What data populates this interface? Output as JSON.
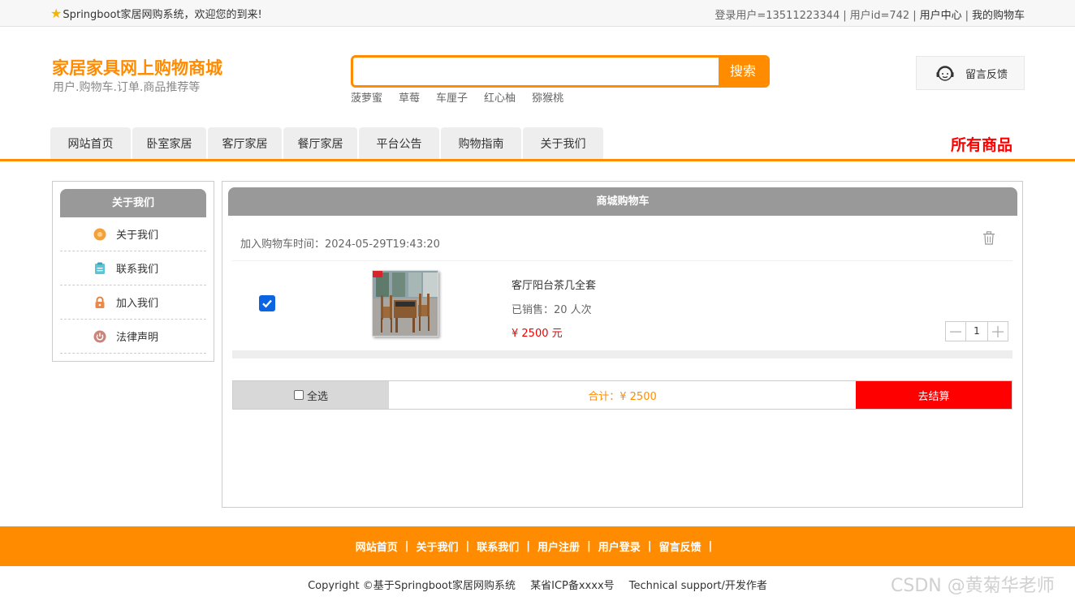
{
  "topbar": {
    "welcome": "Springboot家居网购系统，欢迎您的到来!",
    "login_user": "登录用户=13511223344",
    "user_id": "用户id=742",
    "user_center": "用户中心",
    "my_cart": "我的购物车",
    "separator": "|"
  },
  "header": {
    "title": "家居家具网上购物商城",
    "subtitle": "用户.购物车.订单.商品推荐等",
    "search": {
      "value": "",
      "button": "搜索"
    },
    "hot_words": [
      "菠萝蜜",
      "草莓",
      "车厘子",
      "红心柚",
      "猕猴桃"
    ],
    "feedback": "留言反馈"
  },
  "nav": {
    "items": [
      "网站首页",
      "卧室家居",
      "客厅家居",
      "餐厅家居",
      "平台公告",
      "购物指南",
      "关于我们"
    ],
    "all_goods": "所有商品"
  },
  "sidebar": {
    "title": "关于我们",
    "items": [
      {
        "label": "关于我们",
        "icon": "orange-circle-icon"
      },
      {
        "label": "联系我们",
        "icon": "clipboard-icon"
      },
      {
        "label": "加入我们",
        "icon": "lock-icon"
      },
      {
        "label": "法律声明",
        "icon": "power-icon"
      }
    ]
  },
  "cart": {
    "title": "商城购物车",
    "added_time_label": "加入购物车时间：",
    "added_time": "2024-05-29T19:43:20",
    "item": {
      "name": "客厅阳台茶几全套",
      "sold": "已销售：20 人次",
      "price": "¥ 2500 元",
      "quantity": "1",
      "checked": true
    },
    "select_all": "全选",
    "total": "合计：¥ 2500",
    "checkout": "去结算"
  },
  "footer": {
    "links": [
      "网站首页",
      "关于我们",
      "联系我们",
      "用户注册",
      "用户登录",
      "留言反馈"
    ],
    "copyright": "Copyright ©基于Springboot家居网购系统",
    "icp": "某省ICP备xxxx号",
    "support": "Technical support/开发作者"
  },
  "watermark": "CSDN @黄菊华老师",
  "colors": {
    "accent": "#ff8c00",
    "danger": "#ff0000",
    "header_gray": "#999999"
  }
}
